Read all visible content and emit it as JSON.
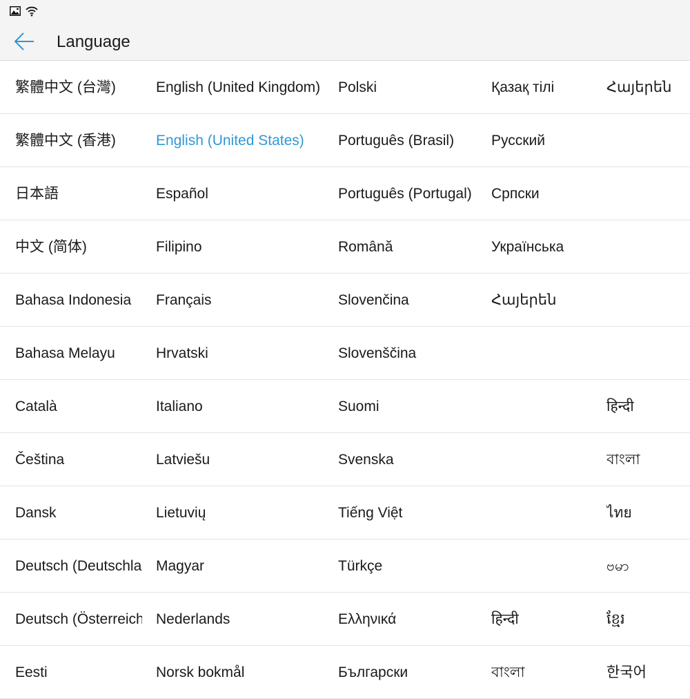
{
  "status_bar": {
    "icons": [
      "image-icon",
      "wifi-icon"
    ]
  },
  "app_bar": {
    "title": "Language",
    "back_icon": "arrow-left-icon"
  },
  "accent_color": "#2f98d6",
  "selected_language": "English (United States)",
  "rows": [
    [
      "繁體中文 (台灣)",
      "English (United Kingdom)",
      "Polski",
      "Қазақ тілі",
      "Հայերեն"
    ],
    [
      "繁體中文 (香港)",
      "English (United States)",
      "Português (Brasil)",
      "Русский",
      ""
    ],
    [
      "日本語",
      "Español",
      "Português (Portugal)",
      "Српски",
      ""
    ],
    [
      "中文 (简体)",
      "Filipino",
      "Română",
      "Українська",
      ""
    ],
    [
      "Bahasa Indonesia",
      "Français",
      "Slovenčina",
      "Հայերեն",
      ""
    ],
    [
      "Bahasa Melayu",
      "Hrvatski",
      "Slovenščina",
      "",
      ""
    ],
    [
      "Català",
      "Italiano",
      "Suomi",
      "",
      "हिन्दी"
    ],
    [
      "Čeština",
      "Latviešu",
      "Svenska",
      "",
      "বাংলা"
    ],
    [
      "Dansk",
      "Lietuvių",
      "Tiếng Việt",
      "",
      "ไทย"
    ],
    [
      "Deutsch (Deutschland)",
      "Magyar",
      "Türkçe",
      "",
      "ဗမာ"
    ],
    [
      "Deutsch (Österreich)",
      "Nederlands",
      "Ελληνικά",
      "हिन्दी",
      "ខ្មែរ"
    ],
    [
      "Eesti",
      "Norsk bokmål",
      "Български",
      "বাংলা",
      "한국어"
    ]
  ]
}
